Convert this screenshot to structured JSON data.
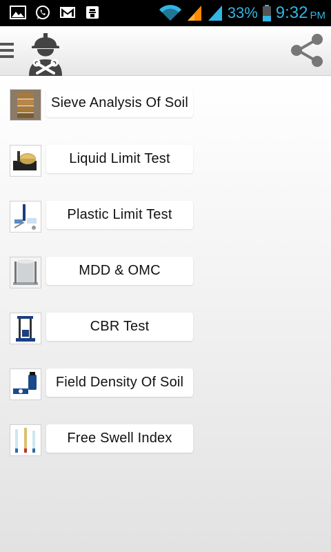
{
  "status_bar": {
    "icons": [
      "gallery-icon",
      "whatsapp-icon",
      "gmail-icon",
      "emblem-icon",
      "wifi-icon",
      "cell-signal-icon",
      "cell-signal-icon",
      "battery-icon"
    ],
    "battery_percent": "33%",
    "time": "9:32",
    "ampm": "PM",
    "accent_color": "#33b5e5"
  },
  "action_bar": {
    "menu_icon": "hamburger-menu-icon",
    "logo_icon": "engineer-with-tools-icon",
    "share_icon": "share-icon"
  },
  "tests": [
    {
      "label": "Sieve Analysis Of Soil",
      "icon": "sieve-stack-icon"
    },
    {
      "label": "Liquid Limit Test",
      "icon": "casagrande-apparatus-icon"
    },
    {
      "label": "Plastic Limit Test",
      "icon": "plastic-limit-tools-icon"
    },
    {
      "label": "MDD & OMC",
      "icon": "proctor-mould-icon"
    },
    {
      "label": "CBR Test",
      "icon": "cbr-machine-icon"
    },
    {
      "label": "Field Density Of Soil",
      "icon": "sand-cone-icon"
    },
    {
      "label": "Free Swell Index",
      "icon": "cylinders-icon"
    }
  ]
}
